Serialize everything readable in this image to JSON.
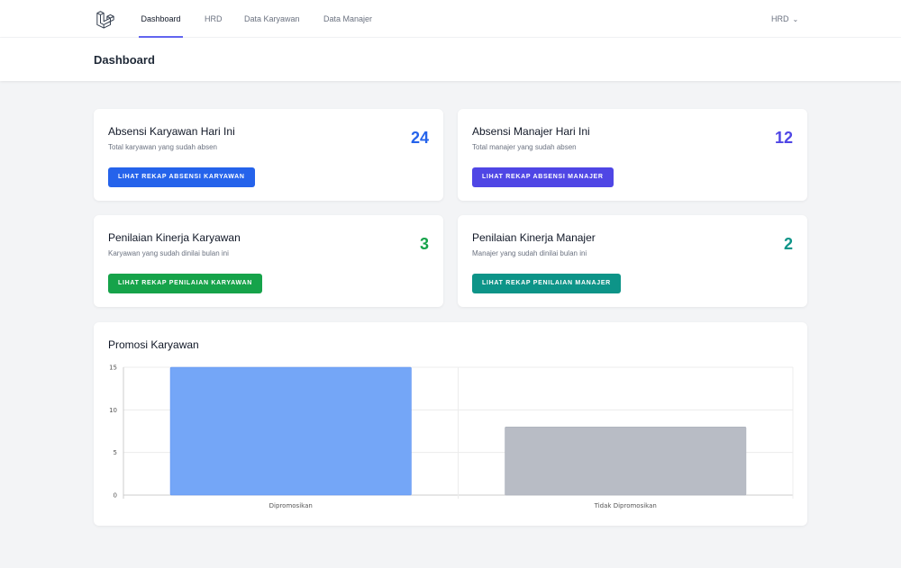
{
  "nav": {
    "links": [
      {
        "label": "Dashboard",
        "active": true
      },
      {
        "label": "HRD",
        "active": false
      },
      {
        "label": "Data Karyawan",
        "active": false
      },
      {
        "label": "Data Manajer",
        "active": false
      }
    ],
    "user": "HRD",
    "logo_icon": "laravel-logo-icon"
  },
  "header": {
    "title": "Dashboard"
  },
  "cards": [
    {
      "title": "Absensi Karyawan Hari Ini",
      "subtitle": "Total karyawan yang sudah absen",
      "count": "24",
      "count_color": "#2563eb",
      "button_label": "LIHAT REKAP ABSENSI KARYAWAN",
      "button_color": "#2563eb"
    },
    {
      "title": "Absensi Manajer Hari Ini",
      "subtitle": "Total manajer yang sudah absen",
      "count": "12",
      "count_color": "#4f46e5",
      "button_label": "LIHAT REKAP ABSENSI MANAJER",
      "button_color": "#4f46e5"
    },
    {
      "title": "Penilaian Kinerja Karyawan",
      "subtitle": "Karyawan yang sudah dinilai bulan ini",
      "count": "3",
      "count_color": "#16a34a",
      "button_label": "LIHAT REKAP PENILAIAN KARYAWAN",
      "button_color": "#16a34a"
    },
    {
      "title": "Penilaian Kinerja Manajer",
      "subtitle": "Manajer yang sudah dinilai bulan ini",
      "count": "2",
      "count_color": "#0d9488",
      "button_label": "LIHAT REKAP PENILAIAN MANAJER",
      "button_color": "#0d9488"
    }
  ],
  "chart_title": "Promosi Karyawan",
  "chart_data": {
    "type": "bar",
    "title": "Promosi Karyawan",
    "categories": [
      "Dipromosikan",
      "Tidak Dipromosikan"
    ],
    "values": [
      15,
      8
    ],
    "colors": [
      "#74a6f7",
      "#b8bcc5"
    ],
    "ylim": [
      0,
      15
    ],
    "yticks": [
      "0",
      "5",
      "10",
      "15"
    ],
    "grid": true,
    "xlabel": "",
    "ylabel": ""
  }
}
